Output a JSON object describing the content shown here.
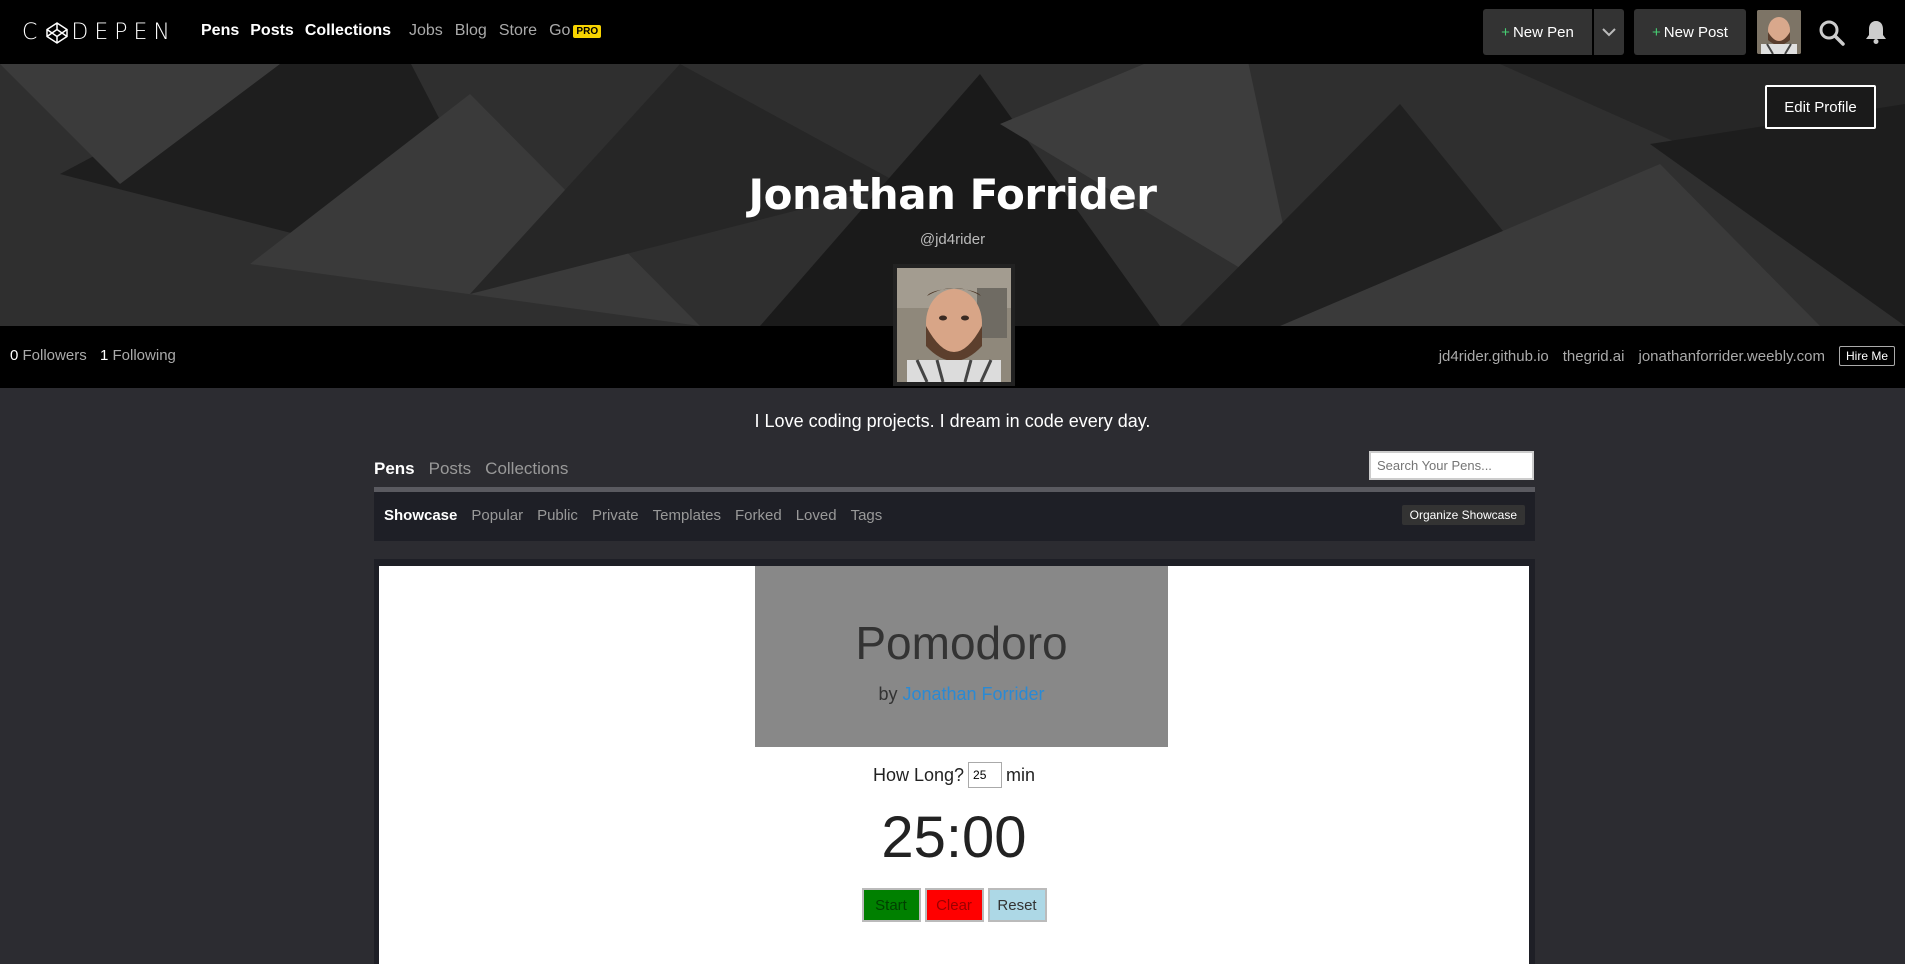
{
  "header": {
    "logo": "CODEPEN",
    "nav_main": [
      "Pens",
      "Posts",
      "Collections"
    ],
    "nav_secondary": [
      "Jobs",
      "Blog",
      "Store",
      "Go"
    ],
    "pro_badge": "PRO",
    "new_pen": "New Pen",
    "new_post": "New Post"
  },
  "profile": {
    "name": "Jonathan Forrider",
    "handle": "@jd4rider",
    "edit_profile": "Edit Profile",
    "followers_count": "0",
    "followers_label": "Followers",
    "following_count": "1",
    "following_label": "Following",
    "links": [
      "jd4rider.github.io",
      "thegrid.ai",
      "jonathanforrider.weebly.com"
    ],
    "hire_me": "Hire Me",
    "bio": "I Love coding projects. I dream in code every day."
  },
  "tabs": [
    "Pens",
    "Posts",
    "Collections"
  ],
  "search_placeholder": "Search Your Pens...",
  "subtabs": [
    "Showcase",
    "Popular",
    "Public",
    "Private",
    "Templates",
    "Forked",
    "Loved",
    "Tags"
  ],
  "organize_showcase": "Organize Showcase",
  "pen_preview": {
    "title": "Pomodoro",
    "by": "by",
    "author": "Jonathan Forrider",
    "how_long": "How Long?",
    "minutes_value": "25",
    "min_label": "min",
    "timer": "25:00",
    "start": "Start",
    "clear": "Clear",
    "reset": "Reset"
  },
  "colors": {
    "accent_green": "#47cf73",
    "pro_yellow": "#f8d400",
    "link_blue": "#2a8ad4"
  }
}
